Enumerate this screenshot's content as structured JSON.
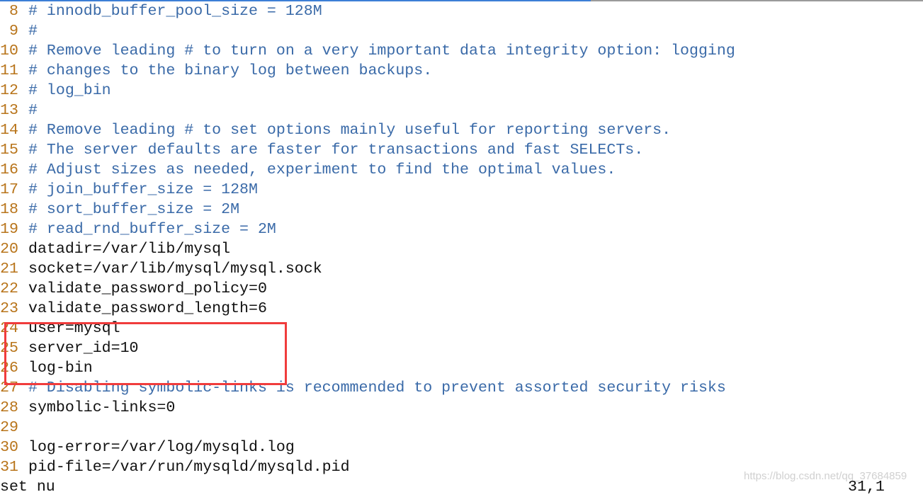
{
  "progress_percent": 64,
  "colors": {
    "line_number": "#b8741a",
    "comment": "#3a6aa8",
    "text": "#111111",
    "highlight_box": "#f03c3c"
  },
  "lines": [
    {
      "n": "8",
      "text": "# innodb_buffer_pool_size = 128M",
      "comment": true
    },
    {
      "n": "9",
      "text": "#",
      "comment": true
    },
    {
      "n": "10",
      "text": "# Remove leading # to turn on a very important data integrity option: logging",
      "comment": true
    },
    {
      "n": "11",
      "text": "# changes to the binary log between backups.",
      "comment": true
    },
    {
      "n": "12",
      "text": "# log_bin",
      "comment": true
    },
    {
      "n": "13",
      "text": "#",
      "comment": true
    },
    {
      "n": "14",
      "text": "# Remove leading # to set options mainly useful for reporting servers.",
      "comment": true
    },
    {
      "n": "15",
      "text": "# The server defaults are faster for transactions and fast SELECTs.",
      "comment": true
    },
    {
      "n": "16",
      "text": "# Adjust sizes as needed, experiment to find the optimal values.",
      "comment": true
    },
    {
      "n": "17",
      "text": "# join_buffer_size = 128M",
      "comment": true
    },
    {
      "n": "18",
      "text": "# sort_buffer_size = 2M",
      "comment": true
    },
    {
      "n": "19",
      "text": "# read_rnd_buffer_size = 2M",
      "comment": true
    },
    {
      "n": "20",
      "text": "datadir=/var/lib/mysql",
      "comment": false
    },
    {
      "n": "21",
      "text": "socket=/var/lib/mysql/mysql.sock",
      "comment": false
    },
    {
      "n": "22",
      "text": "validate_password_policy=0",
      "comment": false
    },
    {
      "n": "23",
      "text": "validate_password_length=6",
      "comment": false
    },
    {
      "n": "24",
      "text": "user=mysql",
      "comment": false
    },
    {
      "n": "25",
      "text": "server_id=10",
      "comment": false
    },
    {
      "n": "26",
      "text": "log-bin",
      "comment": false
    },
    {
      "n": "27",
      "text": "# Disabling symbolic-links is recommended to prevent assorted security risks",
      "comment": true
    },
    {
      "n": "28",
      "text": "symbolic-links=0",
      "comment": false
    },
    {
      "n": "29",
      "text": "",
      "comment": false
    },
    {
      "n": "30",
      "text": "log-error=/var/log/mysqld.log",
      "comment": false
    },
    {
      "n": "31",
      "text": "pid-file=/var/run/mysqld/mysqld.pid",
      "comment": false
    }
  ],
  "status": {
    "command": "set nu",
    "cursor_position": "31,1"
  },
  "watermark": "https://blog.csdn.net/qq_37684859"
}
